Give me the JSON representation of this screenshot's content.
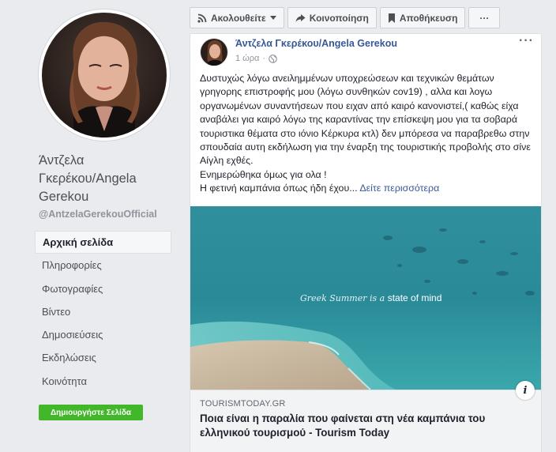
{
  "profile": {
    "name": "Άντζελα Γκερέκου/Angela Gerekou",
    "handle": "@AntzelaGerekouOfficial"
  },
  "nav": {
    "items": [
      {
        "label": "Αρχική σελίδα",
        "active": true
      },
      {
        "label": "Πληροφορίες"
      },
      {
        "label": "Φωτογραφίες"
      },
      {
        "label": "Βίντεο"
      },
      {
        "label": "Δημοσιεύσεις"
      },
      {
        "label": "Εκδηλώσεις"
      },
      {
        "label": "Κοινότητα"
      }
    ],
    "create_page": "Δημιουργήστε Σελίδα"
  },
  "actions": {
    "follow": "Ακολουθείτε",
    "share": "Κοινοποίηση",
    "save": "Αποθήκευση",
    "more": "···"
  },
  "post": {
    "author": "Άντζελα Γκερέκου/Angela Gerekou",
    "time": "1 ώρα",
    "more": "···",
    "body": "Δυστυχώς λόγω ανειλημμένων υποχρεώσεων και τεχνικών θεμάτων γρηγορης επιστροφής μου (λόγω συνθηκών cov19) , αλλα και λογω οργανωμένων συναντήσεων που ειχαν από καιρό κανονιστεί,( καθώς είχα αναβάλει για καιρό λόγω της καραντίνας την επίσκεψη μου για τα σοβαρά τουριστικα θέματα στο ιόνιο Κέρκυρα κτλ) δεν μπόρεσα να παραβρεθω στην σπουδαία αυτη εκδήλωση για την έναρξη της τουριστικής προβολής στο σίνε Αίγλη εχθές.",
    "line2": "Ενημερώθηκα όμως για ολα !",
    "line3": "Η φετινή καμπάνια όπως ήδη έχου...",
    "see_more": "Δείτε περισσότερα",
    "image_caption_italic": "Greek Summer is a",
    "image_caption_bold": "state of mind",
    "info": "i",
    "link": {
      "domain": "TOURISMTODAY.GR",
      "title": "Ποια είναι η παραλία που φαίνεται στη νέα καμπάνια του ελληνικού τουρισμού - Tourism Today"
    }
  },
  "colors": {
    "link": "#385898",
    "green": "#42b72a",
    "background": "#e9ebee"
  }
}
